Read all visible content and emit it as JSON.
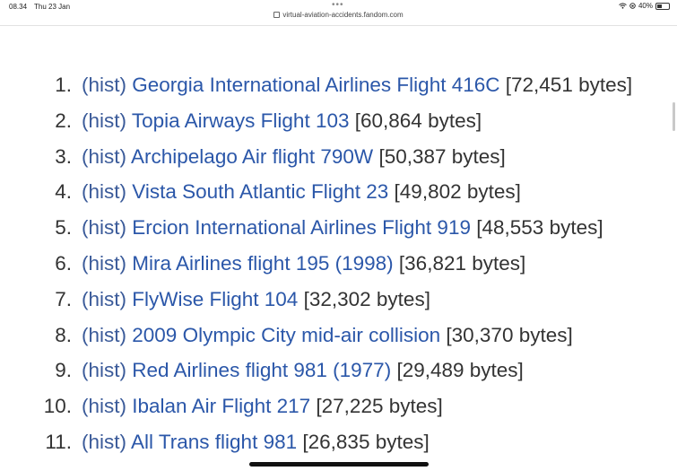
{
  "status_bar": {
    "time": "08.34",
    "date": "Thu 23 Jan",
    "dots": "•••",
    "battery": "40%",
    "battery_level": 0.4
  },
  "browser": {
    "url": "virtual-aviation-accidents.fandom.com"
  },
  "list": [
    {
      "num": "1.",
      "hist": "(hist)",
      "title": "Georgia International Airlines Flight 416C",
      "bytes": "[72,451 bytes]"
    },
    {
      "num": "2.",
      "hist": "(hist)",
      "title": "Topia Airways Flight 103",
      "bytes": "[60,864 bytes]"
    },
    {
      "num": "3.",
      "hist": "(hist)",
      "title": "Archipelago Air flight 790W",
      "bytes": "[50,387 bytes]"
    },
    {
      "num": "4.",
      "hist": "(hist)",
      "title": "Vista South Atlantic Flight 23",
      "bytes": "[49,802 bytes]"
    },
    {
      "num": "5.",
      "hist": "(hist)",
      "title": "Ercion International Airlines Flight 919",
      "bytes": "[48,553 bytes]"
    },
    {
      "num": "6.",
      "hist": "(hist)",
      "title": "Mira Airlines flight 195 (1998)",
      "bytes": "[36,821 bytes]"
    },
    {
      "num": "7.",
      "hist": "(hist)",
      "title": "FlyWise Flight 104",
      "bytes": "[32,302 bytes]"
    },
    {
      "num": "8.",
      "hist": "(hist)",
      "title": "2009 Olympic City mid-air collision",
      "bytes": "[30,370 bytes]"
    },
    {
      "num": "9.",
      "hist": "(hist)",
      "title": "Red Airlines flight 981 (1977)",
      "bytes": "[29,489 bytes]"
    },
    {
      "num": "10.",
      "hist": "(hist)",
      "title": "Ibalan Air Flight 217",
      "bytes": "[27,225 bytes]"
    },
    {
      "num": "11.",
      "hist": "(hist)",
      "title": "All Trans flight 981",
      "bytes": "[26,835 bytes]"
    }
  ]
}
